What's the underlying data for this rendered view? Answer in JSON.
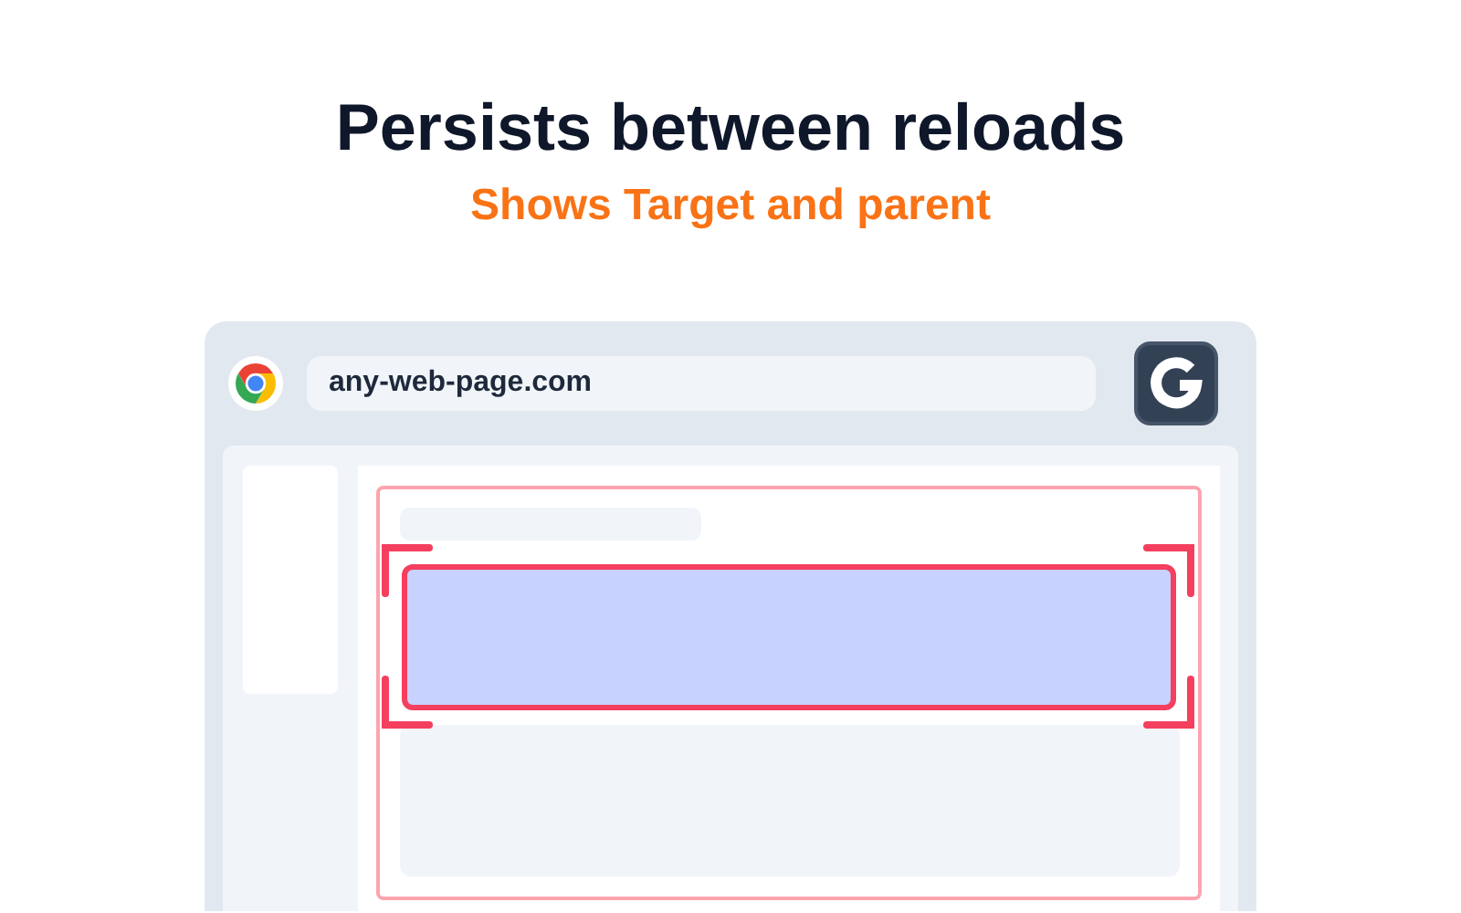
{
  "heading": "Persists between reloads",
  "subheading": "Shows Target and parent",
  "browser": {
    "url": "any-web-page.com"
  }
}
